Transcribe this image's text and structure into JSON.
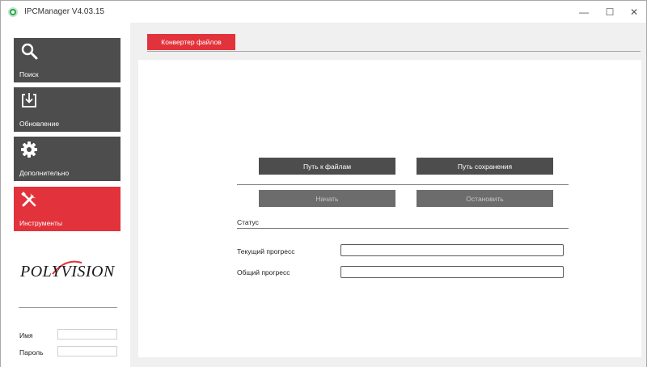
{
  "window": {
    "title": "IPCManager V4.03.15",
    "controls": {
      "minimize": "—",
      "maximize": "☐",
      "close": "✕"
    }
  },
  "sidebar": {
    "items": [
      {
        "label": "Поиск",
        "icon": "search-icon",
        "active": false
      },
      {
        "label": "Обновление",
        "icon": "download-icon",
        "active": false
      },
      {
        "label": "Дополнительно",
        "icon": "gear-icon",
        "active": false
      },
      {
        "label": "Инструменты",
        "icon": "tools-icon",
        "active": true
      }
    ],
    "logo_text": "POLYVISION",
    "login": {
      "name_label": "Имя",
      "name_value": "",
      "password_label": "Пароль",
      "password_value": ""
    }
  },
  "main": {
    "tabs": [
      {
        "label": "Конвертер файлов",
        "active": true
      }
    ],
    "buttons": {
      "file_path": "Путь к файлам",
      "save_path": "Путь сохранения",
      "start": "Начать",
      "stop": "Остановить"
    },
    "status_label": "Статус",
    "progress": {
      "current_label": "Текущий прогресс",
      "current_value": 0,
      "total_label": "Общий прогресс",
      "total_value": 0
    }
  },
  "colors": {
    "accent": "#e2323b",
    "nav_bg": "#4d4d4d",
    "panel_bg": "#ffffff",
    "window_bg": "#f0f0f0"
  }
}
